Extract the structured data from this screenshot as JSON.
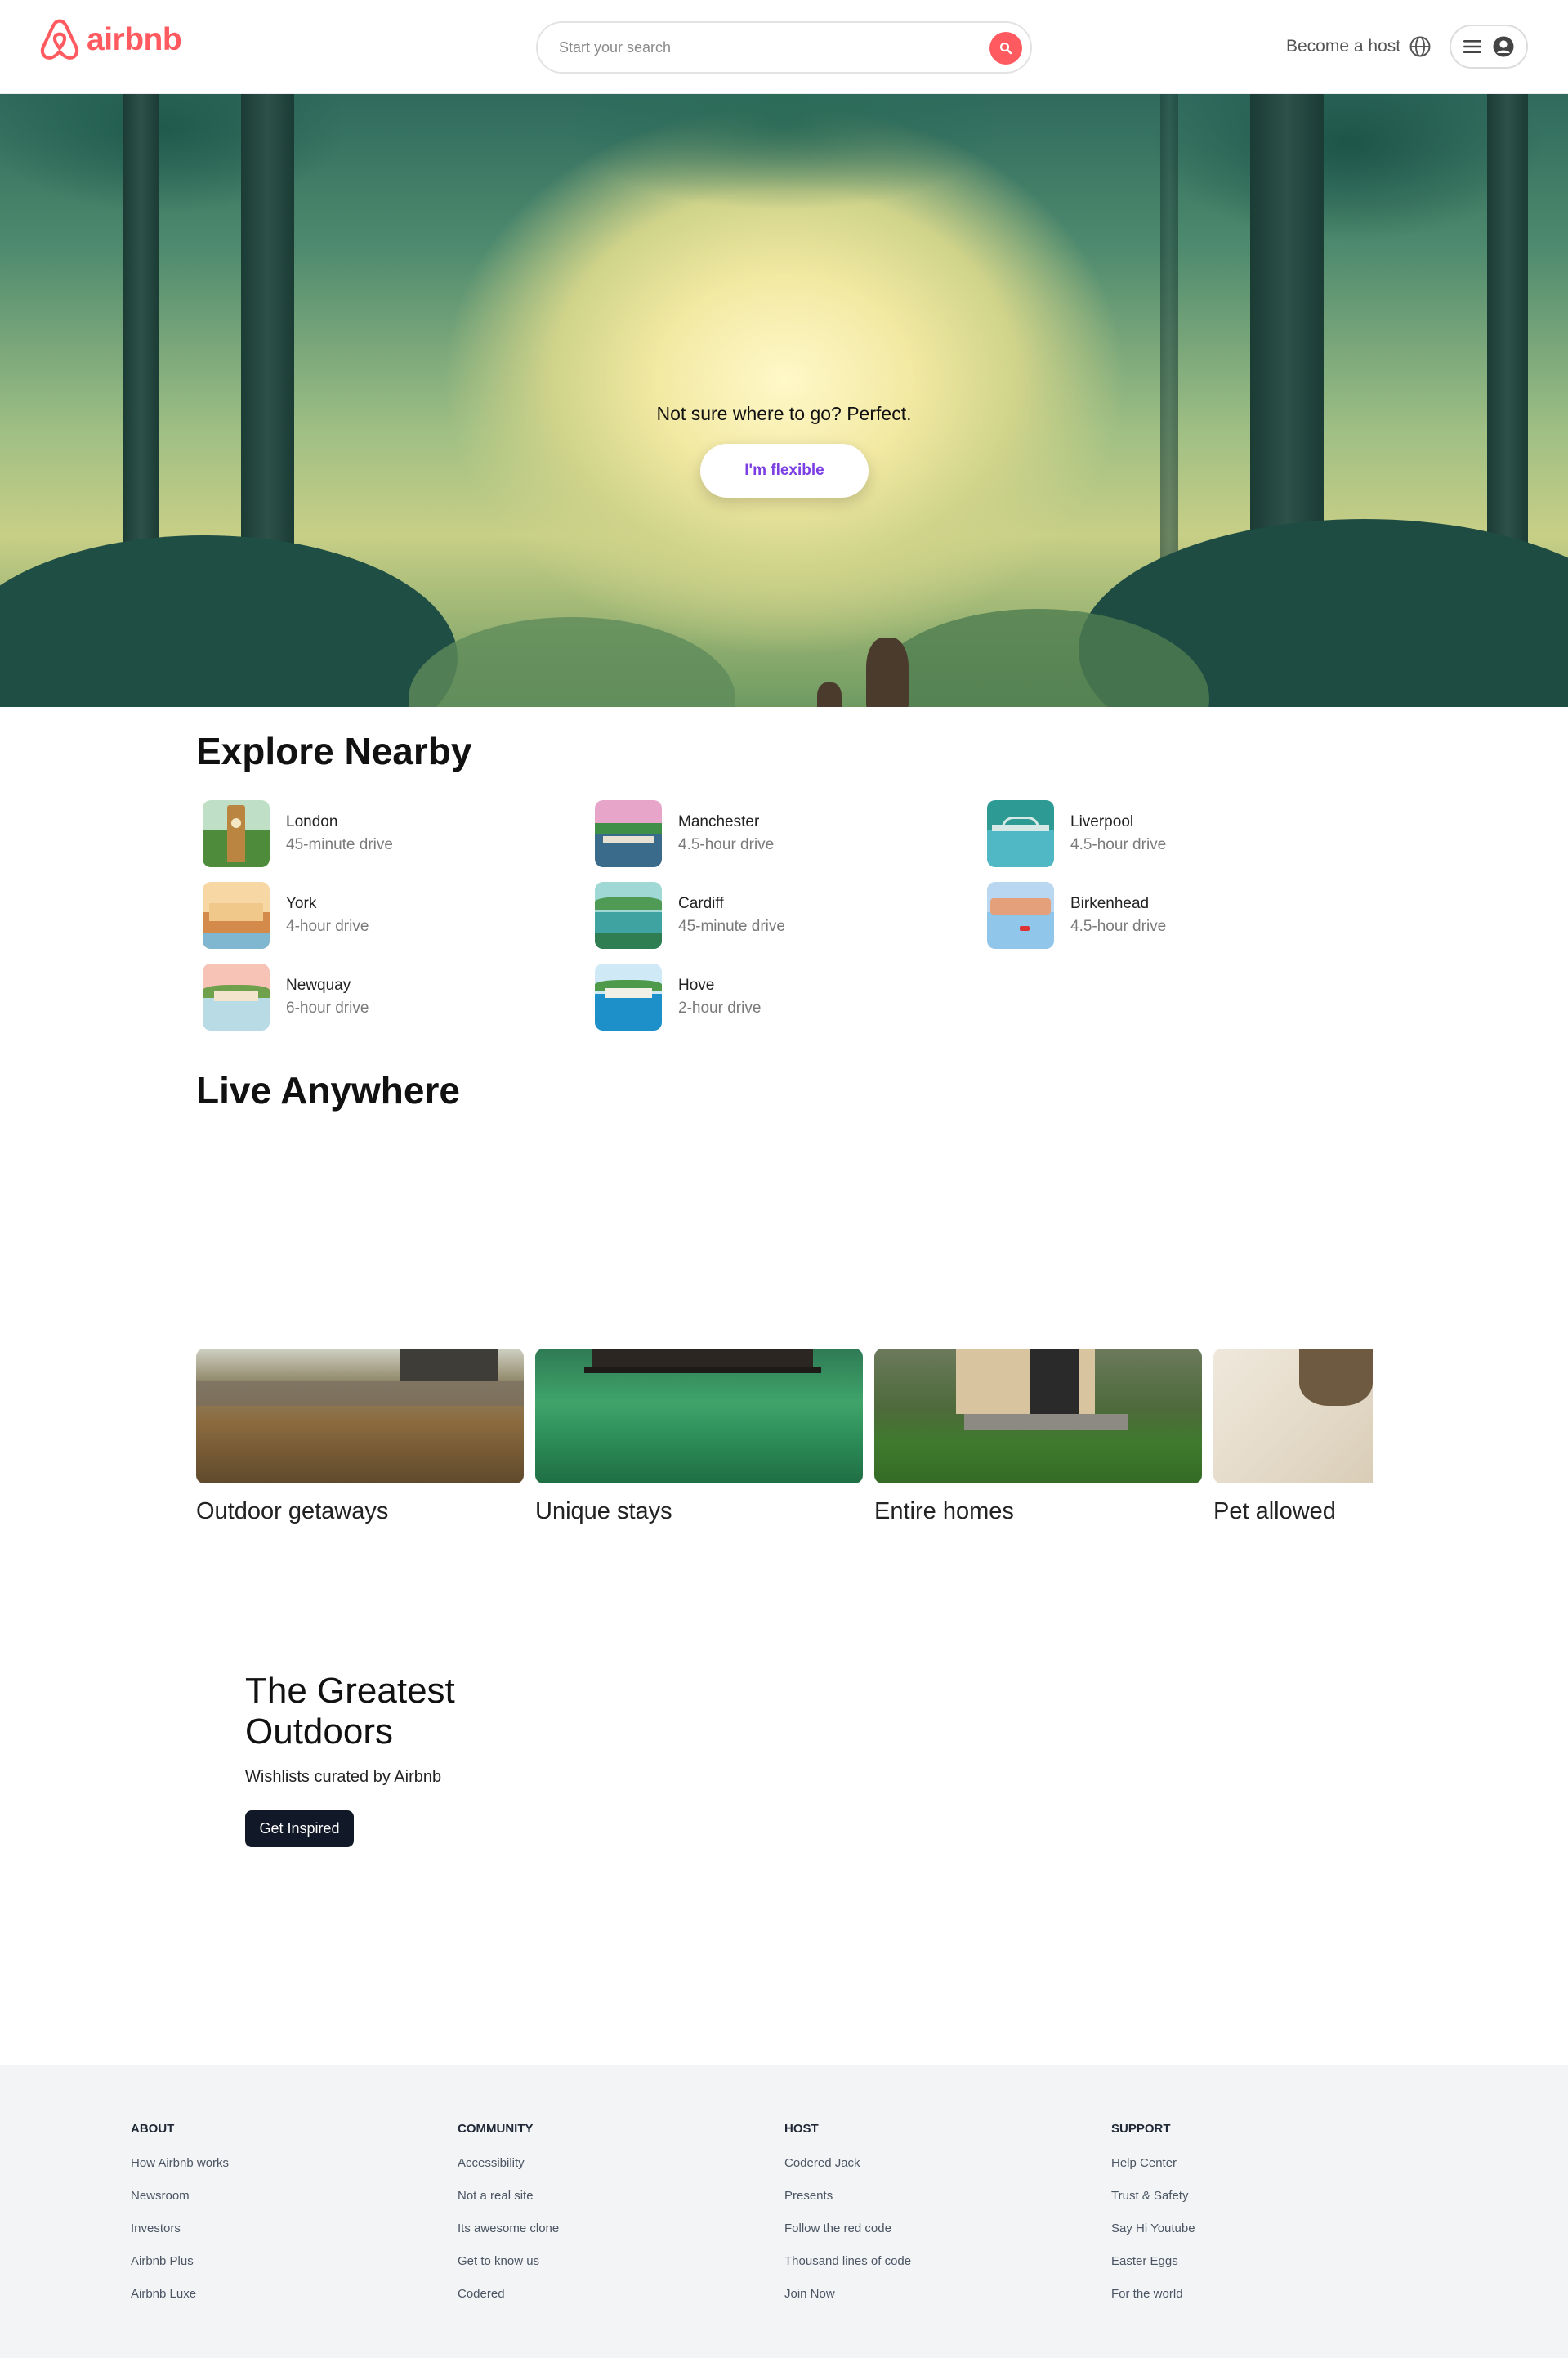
{
  "header": {
    "logo_text": "airbnb",
    "search_placeholder": "Start your search",
    "host_label": "Become a host",
    "brand_color": "#FF5A5F",
    "icons": [
      "airbnb-logo-icon",
      "search-icon",
      "globe-icon",
      "menu-icon",
      "user-icon"
    ]
  },
  "hero": {
    "tagline": "Not sure where to go? Perfect.",
    "button_label": "I'm flexible",
    "button_color": "#7B3FE4"
  },
  "explore": {
    "title": "Explore Nearby",
    "items": [
      {
        "city": "London",
        "distance": "45-minute drive"
      },
      {
        "city": "Manchester",
        "distance": "4.5-hour drive"
      },
      {
        "city": "Liverpool",
        "distance": "4.5-hour drive"
      },
      {
        "city": "York",
        "distance": "4-hour drive"
      },
      {
        "city": "Cardiff",
        "distance": "45-minute drive"
      },
      {
        "city": "Birkenhead",
        "distance": "4.5-hour drive"
      },
      {
        "city": "Newquay",
        "distance": "6-hour drive"
      },
      {
        "city": "Hove",
        "distance": "2-hour drive"
      }
    ]
  },
  "live": {
    "title": "Live Anywhere",
    "cards": [
      {
        "title": "Outdoor getaways"
      },
      {
        "title": "Unique stays"
      },
      {
        "title": "Entire homes"
      },
      {
        "title": "Pet allowed"
      }
    ]
  },
  "outdoors": {
    "title": "The Greatest Outdoors",
    "subtitle": "Wishlists curated by Airbnb",
    "button_label": "Get Inspired"
  },
  "footer": {
    "columns": [
      {
        "heading": "ABOUT",
        "links": [
          "How Airbnb works",
          "Newsroom",
          "Investors",
          "Airbnb Plus",
          "Airbnb Luxe"
        ]
      },
      {
        "heading": "COMMUNITY",
        "links": [
          "Accessibility",
          "Not a real site",
          "Its awesome clone",
          "Get to know us",
          "Codered"
        ]
      },
      {
        "heading": "HOST",
        "links": [
          "Codered Jack",
          "Presents",
          "Follow the red code",
          "Thousand lines of code",
          "Join Now"
        ]
      },
      {
        "heading": "SUPPORT",
        "links": [
          "Help Center",
          "Trust & Safety",
          "Say Hi Youtube",
          "Easter Eggs",
          "For the world"
        ]
      }
    ]
  }
}
